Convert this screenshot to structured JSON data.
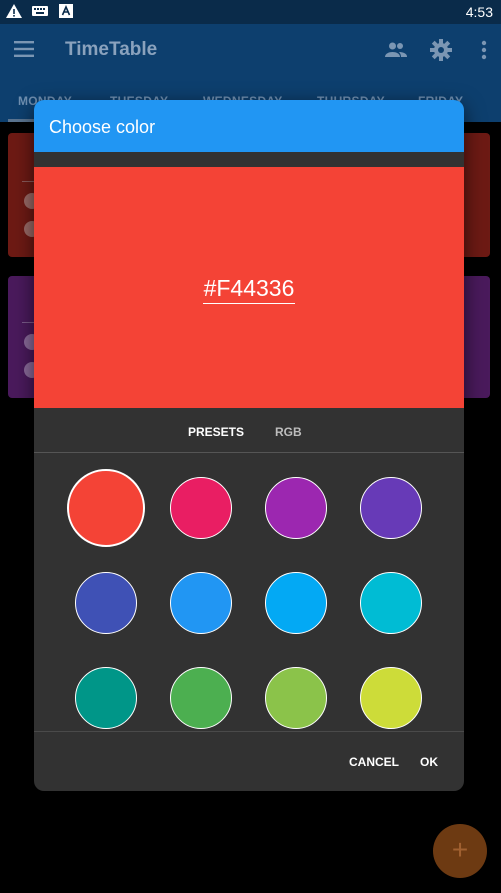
{
  "status_bar": {
    "time": "4:53",
    "icons": [
      "warning-icon",
      "keyboard-icon",
      "a-box-icon"
    ]
  },
  "app_bar": {
    "title": "TimeTable",
    "actions": [
      "people-icon",
      "gear-icon",
      "more-vert-icon"
    ],
    "tabs": [
      {
        "label": "MONDAY"
      },
      {
        "label": "TUESDAY"
      },
      {
        "label": "WEDNESDAY"
      },
      {
        "label": "THURSDAY"
      },
      {
        "label": "FRIDAY"
      }
    ]
  },
  "background_cards": [
    {
      "color": "#6d1a14"
    },
    {
      "color": "#4a1a5c"
    }
  ],
  "fab": {
    "label": "+"
  },
  "dialog": {
    "title": "Choose color",
    "hex_value": "#F44336",
    "selected_color": "#F44336",
    "modes": [
      {
        "label": "PRESETS",
        "active": true
      },
      {
        "label": "RGB",
        "active": false
      }
    ],
    "presets": [
      {
        "color": "#F44336",
        "selected": true
      },
      {
        "color": "#E91E63"
      },
      {
        "color": "#9C27B0"
      },
      {
        "color": "#673AB7"
      },
      {
        "color": "#3F51B5"
      },
      {
        "color": "#2196F3"
      },
      {
        "color": "#03A9F4"
      },
      {
        "color": "#00BCD4"
      },
      {
        "color": "#009688"
      },
      {
        "color": "#4CAF50"
      },
      {
        "color": "#8BC34A"
      },
      {
        "color": "#CDDC39"
      }
    ],
    "cancel_label": "CANCEL",
    "ok_label": "OK"
  }
}
